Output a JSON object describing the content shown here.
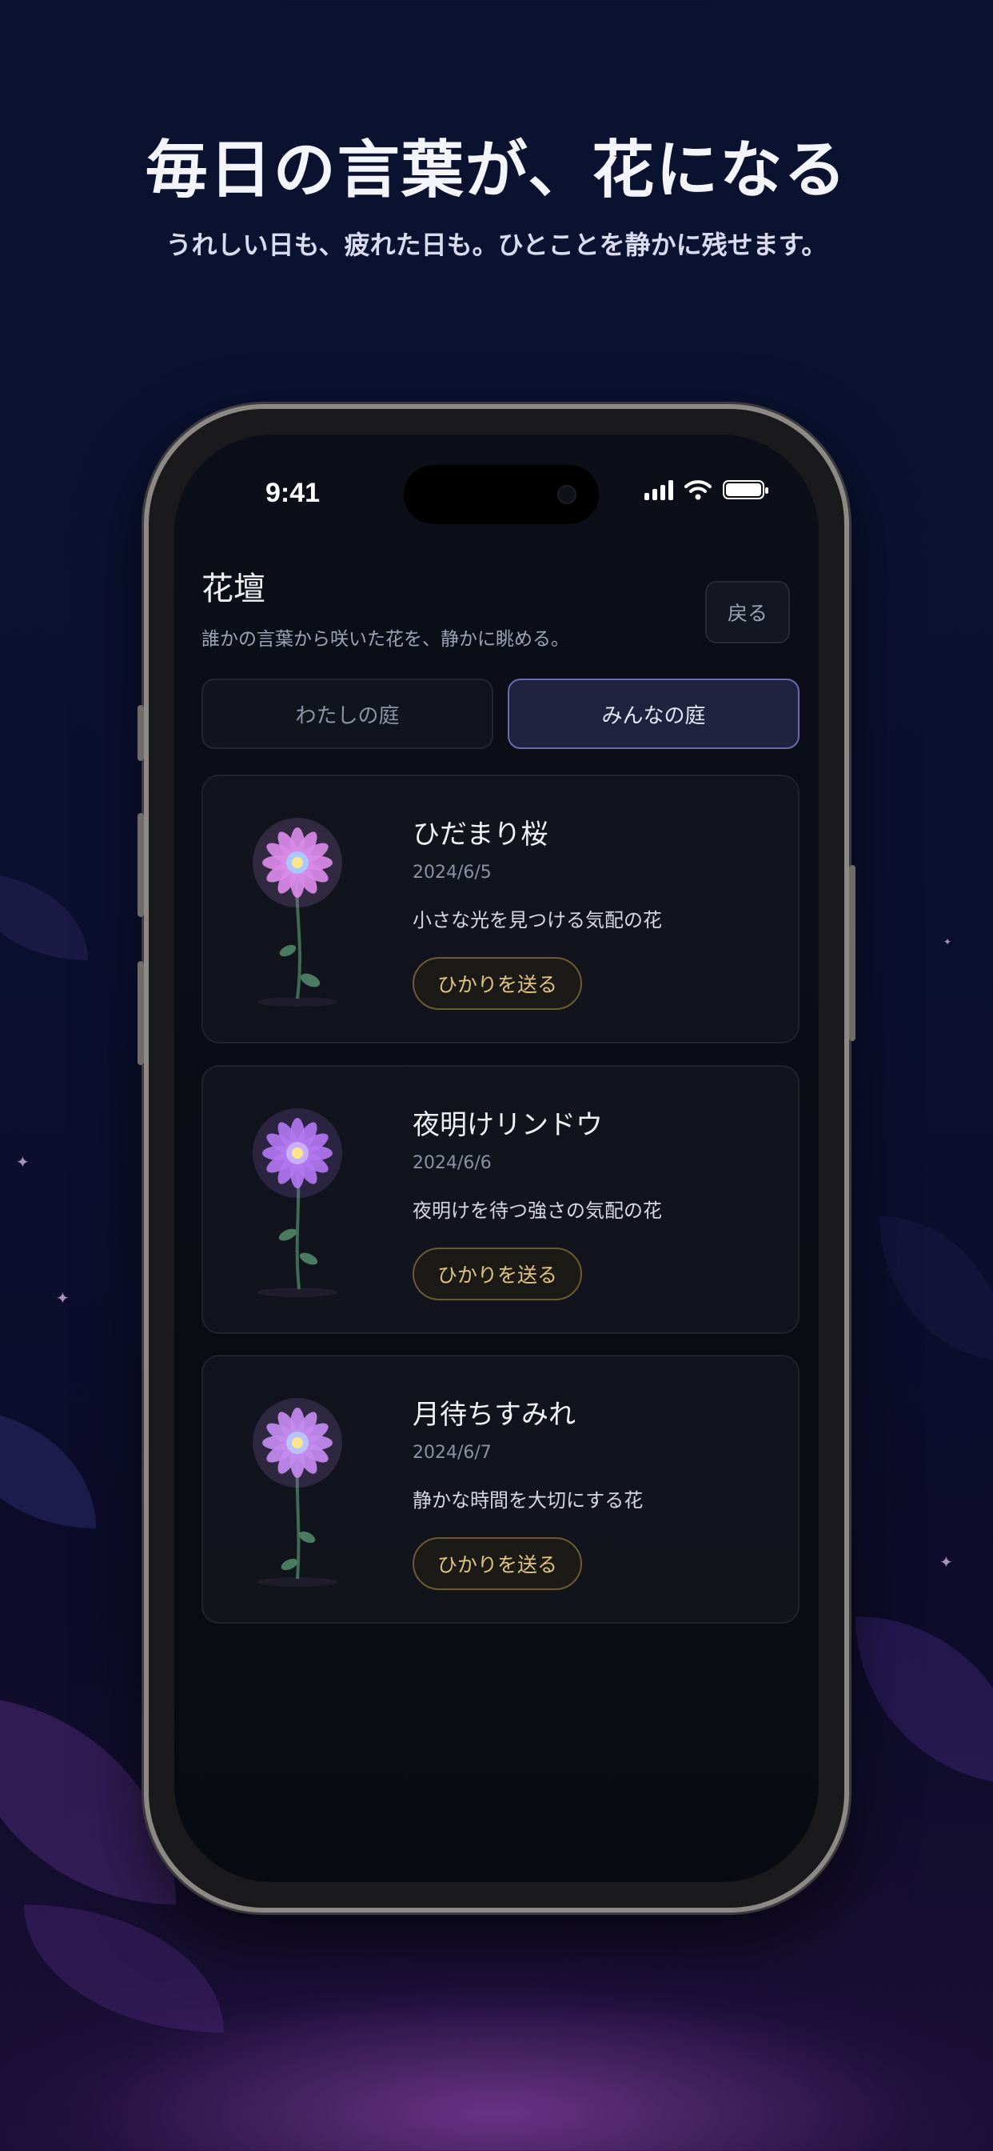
{
  "marketing": {
    "headline": "毎日の言葉が、花になる",
    "subline": "うれしい日も、疲れた日も。ひとことを静かに残せます。"
  },
  "status_bar": {
    "time": "9:41"
  },
  "header": {
    "title": "花壇",
    "subtitle": "誰かの言葉から咲いた花を、静かに眺める。",
    "back_label": "戻る"
  },
  "tabs": [
    {
      "label": "わたしの庭",
      "active": false
    },
    {
      "label": "みんなの庭",
      "active": true
    }
  ],
  "cards": [
    {
      "title": "ひだまり桜",
      "date": "2024/6/5",
      "description": "小さな光を見つける気配の花",
      "button_label": "ひかりを送る",
      "petal_color": "#d98ae8"
    },
    {
      "title": "夜明けリンドウ",
      "date": "2024/6/6",
      "description": "夜明けを待つ強さの気配の花",
      "button_label": "ひかりを送る",
      "petal_color": "#b277f0"
    },
    {
      "title": "月待ちすみれ",
      "date": "2024/6/7",
      "description": "静かな時間を大切にする花",
      "button_label": "ひかりを送る",
      "petal_color": "#c48af0"
    }
  ],
  "colors": {
    "accent": "#6a6ab0",
    "button_gold": "#e0c580"
  }
}
